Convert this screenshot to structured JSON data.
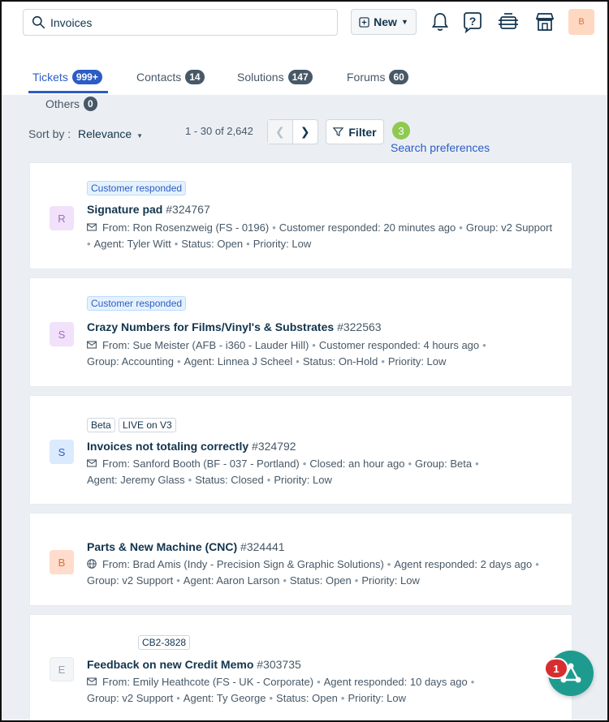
{
  "search": {
    "value": "Invoices"
  },
  "header": {
    "new_label": "New",
    "avatar": "B"
  },
  "tabs": [
    {
      "label": "Tickets",
      "count": "999+"
    },
    {
      "label": "Contacts",
      "count": "14"
    },
    {
      "label": "Solutions",
      "count": "147"
    },
    {
      "label": "Forums",
      "count": "60"
    },
    {
      "label": "Others",
      "count": "0"
    }
  ],
  "toolbar": {
    "sort_label": "Sort by :",
    "sort_value": "Relevance",
    "pagination": "1 - 30 of 2,642",
    "filter_label": "Filter",
    "filter_count": "3",
    "search_preferences": "Search preferences"
  },
  "tickets": [
    {
      "avatar": "R",
      "tags": [
        "Customer responded"
      ],
      "title": "Signature pad",
      "number": "#324767",
      "from": "From:  Ron Rosenzweig (FS - 0196)",
      "status_time": "Customer responded: 20 minutes ago",
      "group": "Group: v2 Support",
      "agent": "Agent: Tyler Witt",
      "status": "Status: Open",
      "priority": "Priority: Low"
    },
    {
      "avatar": "S",
      "tags": [
        "Customer responded"
      ],
      "title": "Crazy Numbers for Films/Vinyl's & Substrates",
      "number": "#322563",
      "from": "From:  Sue Meister (AFB - i360 - Lauder Hill)",
      "status_time": "Customer responded: 4 hours ago",
      "group": "Group: Accounting",
      "agent": "Agent: Linnea J Scheel",
      "status": "Status: On-Hold",
      "priority": "Priority: Low"
    },
    {
      "avatar": "S",
      "tags": [
        "Beta",
        "LIVE on V3"
      ],
      "title": "Invoices not totaling correctly",
      "number": "#324792",
      "from": "From:  Sanford Booth (BF - 037 - Portland)",
      "status_time": "Closed: an hour ago",
      "group": "Group: Beta",
      "agent": "Agent: Jeremy Glass",
      "status": "Status: Closed",
      "priority": "Priority: Low"
    },
    {
      "avatar": "B",
      "tags": [],
      "title": "Parts & New Machine (CNC)",
      "number": "#324441",
      "from": "From:  Brad Amis (Indy - Precision Sign & Graphic Solutions)",
      "status_time": "Agent responded: 2 days ago",
      "group": "Group: v2 Support",
      "agent": "Agent: Aaron Larson",
      "status": "Status: Open",
      "priority": "Priority: Low"
    },
    {
      "avatar": "E",
      "tags": [
        "CB2-3828"
      ],
      "title": "Feedback on new Credit Memo",
      "number": "#303735",
      "from": "From:  Emily Heathcote (FS - UK - Corporate)",
      "status_time": "Agent responded: 10 days ago",
      "group": "Group: v2 Support",
      "agent": "Agent: Ty George",
      "status": "Status: Open",
      "priority": "Priority: Low"
    }
  ],
  "fab": {
    "badge": "1"
  },
  "colors": {
    "accent": "#2c5cc5",
    "fab": "#1e9b8f",
    "badge": "#d72d30",
    "filter_badge": "#8fc951"
  }
}
